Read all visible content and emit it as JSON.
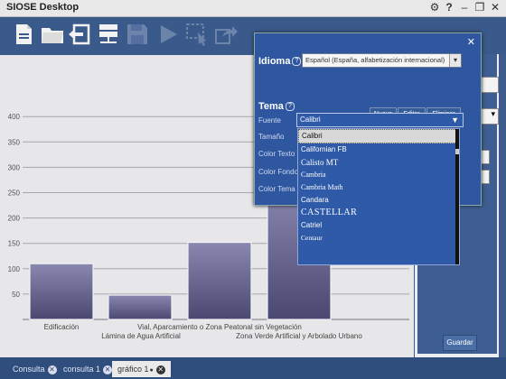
{
  "window": {
    "title": "SIOSE Desktop",
    "controls": [
      "gear-icon",
      "help-icon",
      "minimize-icon",
      "restore-icon",
      "close-icon"
    ]
  },
  "toolbar": {
    "icons": [
      "new-document-icon",
      "open-folder-icon",
      "back-icon",
      "server-icon",
      "save-icon",
      "play-icon",
      "select-area-icon",
      "export-icon"
    ]
  },
  "chart_data": {
    "type": "bar",
    "categories": [
      "Edificación",
      "Lámina de Agua Artificial",
      "Vial, Aparcamiento o Zona Peatonal sin Vegetación",
      "Zona Verde Artificial y Arbolado Urbano"
    ],
    "values": [
      110,
      48,
      152,
      260
    ],
    "ylim": [
      0,
      430
    ],
    "yticks": [
      50,
      100,
      150,
      200,
      250,
      300,
      350,
      400
    ],
    "grid": true,
    "colors": {
      "bar_top": "#8a88b0",
      "bar_bottom": "#4a4770",
      "bar_border": "#f2f2f8"
    }
  },
  "dialog": {
    "idioma_label": "Idioma",
    "idioma_value": "Español (España, alfabetización internacional)",
    "buttons": [
      "Nuevo",
      "Editar",
      "Eliminar"
    ],
    "tema_label": "Tema",
    "fields": [
      "Fuente",
      "Tamaño",
      "Color Texto",
      "Color Fondo",
      "Color Tema"
    ],
    "fuente_value": "Calibri",
    "font_options": [
      "Calibri",
      "Californian FB",
      "Calisto MT",
      "Cambria",
      "Cambria Math",
      "Candara",
      "CASTELLAR",
      "Catriel",
      "Centaur"
    ]
  },
  "right_panel": {
    "guardar_label": "Guardar"
  },
  "tabs": [
    {
      "label": "Consulta"
    },
    {
      "label": "consulta 1"
    },
    {
      "label": "gráfico 1"
    }
  ],
  "colors": {
    "app_bg": "#3d5c8c",
    "dialog_bg": "#2f57a0",
    "chart_bg": "#e7e6e8"
  }
}
